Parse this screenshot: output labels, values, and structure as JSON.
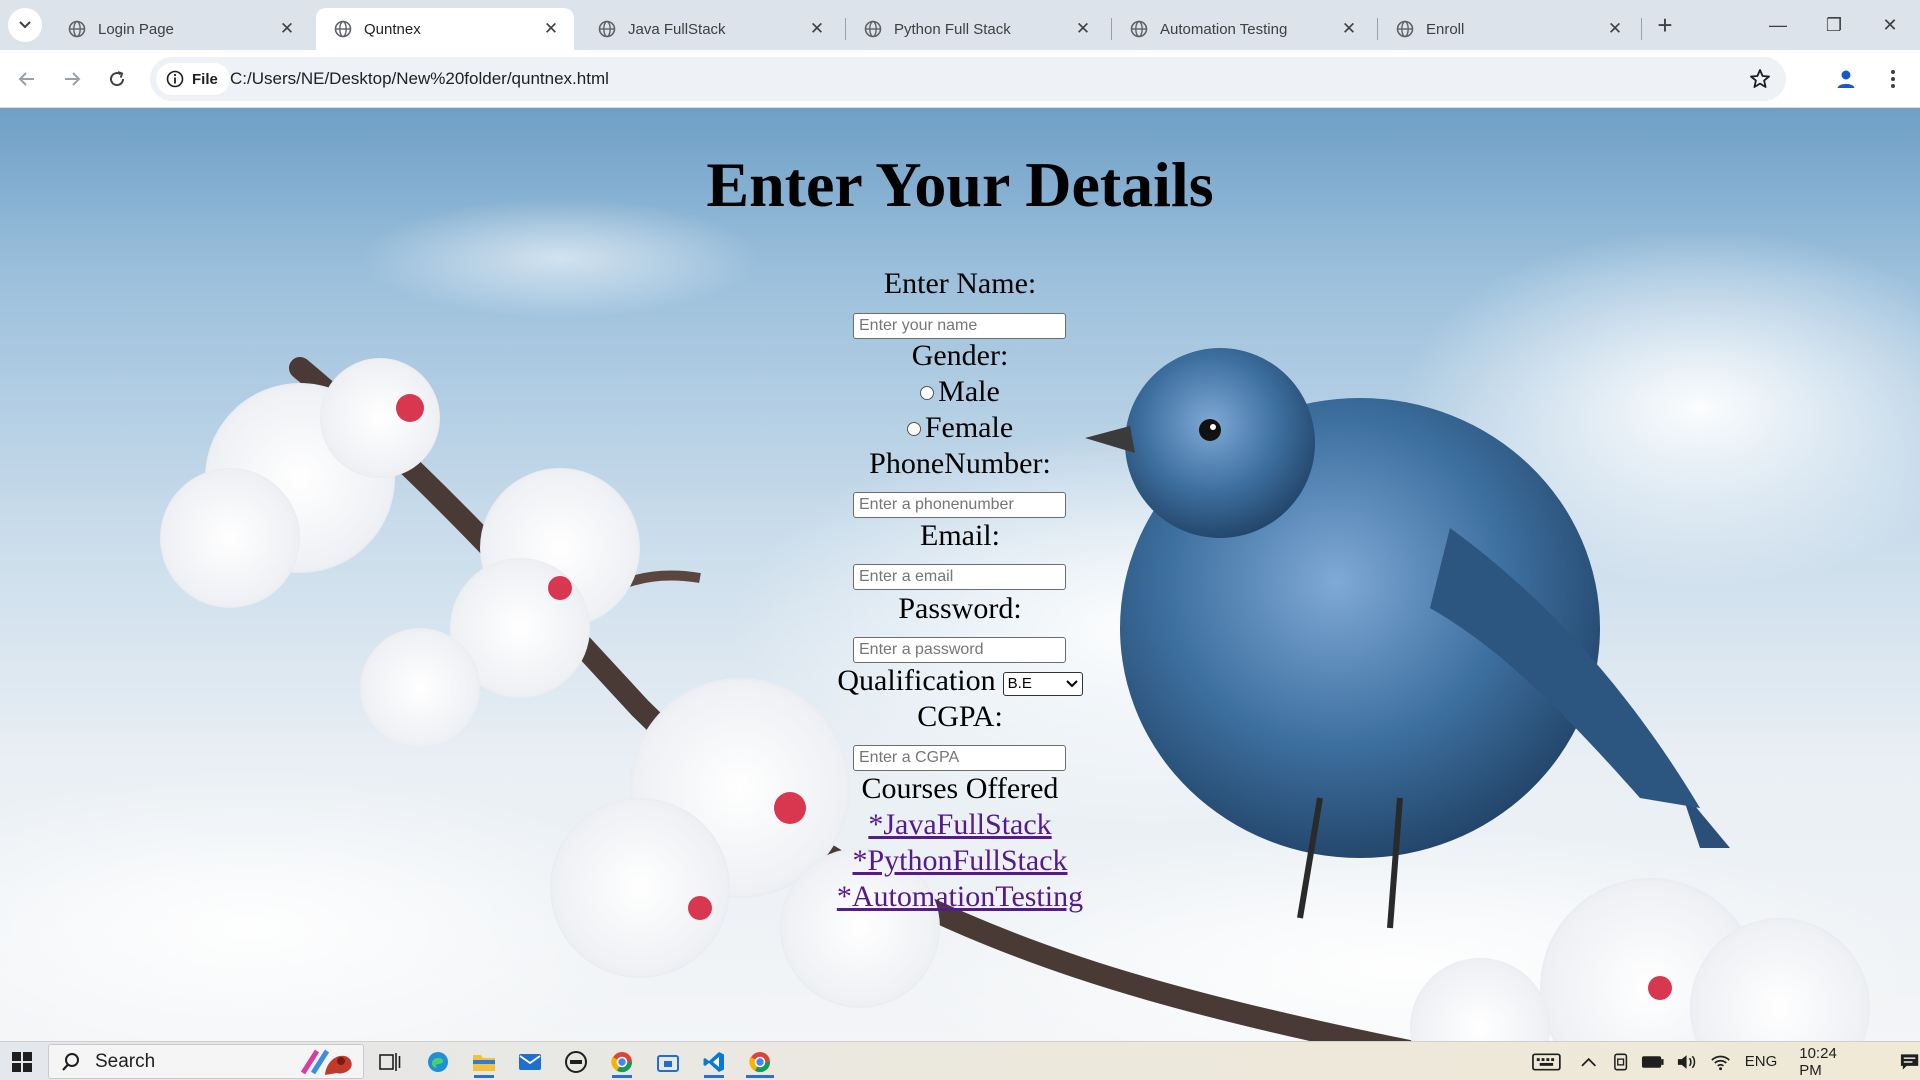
{
  "browser": {
    "tabs": [
      {
        "label": "Login Page",
        "active": false
      },
      {
        "label": "Quntnex",
        "active": true
      },
      {
        "label": "Java FullStack",
        "active": false
      },
      {
        "label": "Python Full Stack",
        "active": false
      },
      {
        "label": "Automation Testing",
        "active": false
      },
      {
        "label": "Enroll",
        "active": false
      }
    ],
    "tab_close": "✕",
    "new_tab": "+",
    "window_controls": {
      "minimize": "—",
      "restore": "❐",
      "close": "✕"
    },
    "site_chip": "File",
    "url": "C:/Users/NE/Desktop/New%20folder/quntnex.html"
  },
  "form": {
    "title": "Enter Your Details",
    "name_label": "Enter Name:",
    "name_placeholder": "Enter your name",
    "gender_label": "Gender:",
    "gender_options": [
      "Male",
      "Female"
    ],
    "phone_label": "PhoneNumber:",
    "phone_placeholder": "Enter a phonenumber",
    "email_label": "Email:",
    "email_placeholder": "Enter a email",
    "password_label": "Password:",
    "password_placeholder": "Enter a password",
    "qualification_label": "Qualification",
    "qualification_selected": "B.E",
    "cgpa_label": "CGPA:",
    "cgpa_placeholder": "Enter a CGPA",
    "courses_heading": "Courses Offered",
    "courses": [
      "*JavaFullStack",
      "*PythonFullStack",
      "*AutomationTesting"
    ]
  },
  "taskbar": {
    "search_label": "Search",
    "language": "ENG",
    "time": "10:24 PM"
  },
  "colors": {
    "link_visited": "#551a8b",
    "bird_blue": "#3d6f9e",
    "blossom_pink": "#d8374f"
  },
  "icons": [
    "tab-search-icon",
    "globe-icon",
    "back-arrow-icon",
    "forward-arrow-icon",
    "reload-icon",
    "info-icon",
    "star-icon",
    "profile-icon",
    "menu-icon",
    "windows-start-icon",
    "search-icon",
    "task-view-icon",
    "edge-icon",
    "file-explorer-icon",
    "mail-icon",
    "chrome-icon",
    "vscode-icon",
    "keyboard-icon",
    "chevron-up-icon",
    "wifi-icon",
    "battery-icon",
    "volume-icon",
    "notification-icon"
  ]
}
